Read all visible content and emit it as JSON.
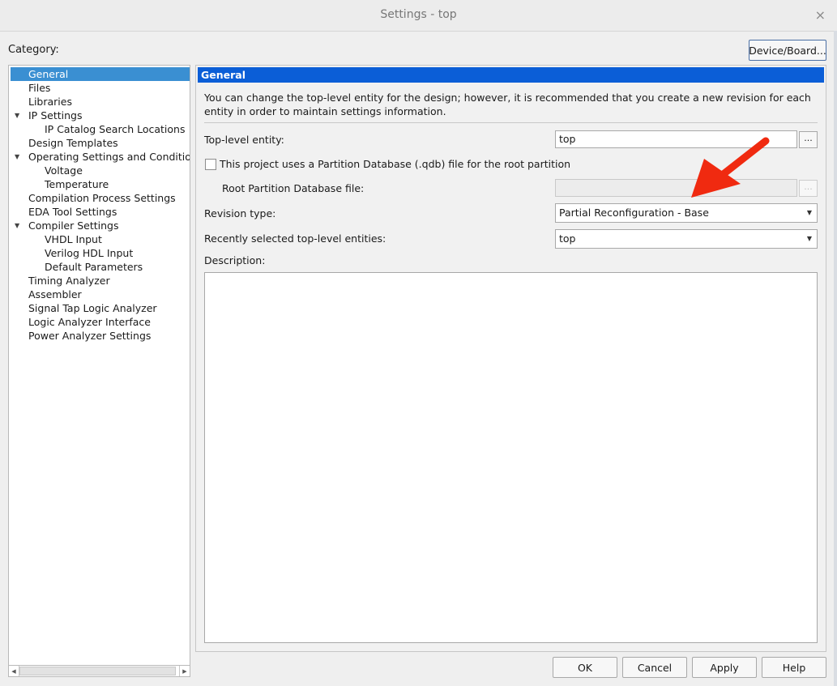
{
  "window": {
    "title": "Settings - top",
    "close_glyph": "×"
  },
  "category_label": "Category:",
  "device_board_button": "Device/Board...",
  "tree": {
    "items": [
      {
        "label": "General",
        "level": 0,
        "selected": true
      },
      {
        "label": "Files",
        "level": 0
      },
      {
        "label": "Libraries",
        "level": 0
      },
      {
        "label": "IP Settings",
        "level": 0,
        "expanded": true
      },
      {
        "label": "IP Catalog Search Locations",
        "level": 1
      },
      {
        "label": "Design Templates",
        "level": 0
      },
      {
        "label": "Operating Settings and Conditions",
        "level": 0,
        "expanded": true
      },
      {
        "label": "Voltage",
        "level": 1
      },
      {
        "label": "Temperature",
        "level": 1
      },
      {
        "label": "Compilation Process Settings",
        "level": 0
      },
      {
        "label": "EDA Tool Settings",
        "level": 0
      },
      {
        "label": "Compiler Settings",
        "level": 0,
        "expanded": true
      },
      {
        "label": "VHDL Input",
        "level": 1
      },
      {
        "label": "Verilog HDL Input",
        "level": 1
      },
      {
        "label": "Default Parameters",
        "level": 1
      },
      {
        "label": "Timing Analyzer",
        "level": 0
      },
      {
        "label": "Assembler",
        "level": 0
      },
      {
        "label": "Signal Tap Logic Analyzer",
        "level": 0
      },
      {
        "label": "Logic Analyzer Interface",
        "level": 0
      },
      {
        "label": "Power Analyzer Settings",
        "level": 0
      }
    ]
  },
  "general": {
    "header": "General",
    "intro": "You can change the top-level entity for the design; however, it is recommended that you create a new revision for each entity in order to maintain settings information.",
    "top_level_label": "Top-level entity:",
    "top_level_value": "top",
    "browse_label": "...",
    "qdb_checkbox_label": "This project uses a Partition Database (.qdb) file for the root partition",
    "qdb_checked": false,
    "root_db_label": "Root Partition Database file:",
    "root_db_value": "",
    "revision_type_label": "Revision type:",
    "revision_type_value": "Partial Reconfiguration - Base",
    "recent_label": "Recently selected top-level entities:",
    "recent_value": "top",
    "description_label": "Description:",
    "description_value": ""
  },
  "buttons": {
    "ok": "OK",
    "cancel": "Cancel",
    "apply": "Apply",
    "help": "Help"
  },
  "colors": {
    "selection": "#3a8fd2",
    "panel_header": "#0b5ed7",
    "annotation_arrow": "#f02a10"
  }
}
